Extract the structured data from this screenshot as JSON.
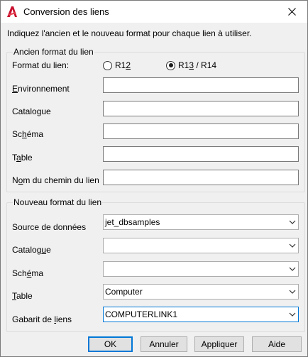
{
  "window": {
    "title": "Conversion des liens",
    "close_symbol": "✕"
  },
  "instruction": "Indiquez l'ancien et le nouveau format pour chaque lien à utiliser.",
  "old_group": {
    "title": "Ancien format du lien",
    "format_label": "Format du lien:",
    "radio_r12": {
      "label_pre": "R1",
      "label_u": "2",
      "label_post": "",
      "selected": false
    },
    "radio_r13": {
      "label_pre": "R1",
      "label_u": "3",
      "label_post": " / R14",
      "selected": true
    },
    "fields": [
      {
        "pre": "",
        "u": "E",
        "post": "nvironnement",
        "value": ""
      },
      {
        "pre": "Catalo",
        "u": "g",
        "post": "ue",
        "value": ""
      },
      {
        "pre": "Sc",
        "u": "h",
        "post": "éma",
        "value": ""
      },
      {
        "pre": "T",
        "u": "a",
        "post": "ble",
        "value": ""
      },
      {
        "pre": "N",
        "u": "o",
        "post": "m du chemin du lien",
        "value": ""
      }
    ]
  },
  "new_group": {
    "title": "Nouveau format du lien",
    "fields": [
      {
        "pre": "Source de données",
        "u": "",
        "post": "",
        "value": "jet_dbsamples"
      },
      {
        "pre": "Catalog",
        "u": "u",
        "post": "e",
        "value": ""
      },
      {
        "pre": "Sch",
        "u": "é",
        "post": "ma",
        "value": ""
      },
      {
        "pre": "",
        "u": "T",
        "post": "able",
        "value": "Computer"
      },
      {
        "pre": "Gabarit de ",
        "u": "l",
        "post": "iens",
        "value": "COMPUTERLINK1"
      }
    ]
  },
  "buttons": {
    "ok": "OK",
    "cancel": "Annuler",
    "apply": "Appliquer",
    "help": "Aide"
  },
  "icons": {
    "app": "autocad-a-icon",
    "close": "close-icon",
    "dropdown": "chevron-down-icon"
  },
  "colors": {
    "accent": "#0078d7",
    "app_icon": "#c8102e"
  }
}
